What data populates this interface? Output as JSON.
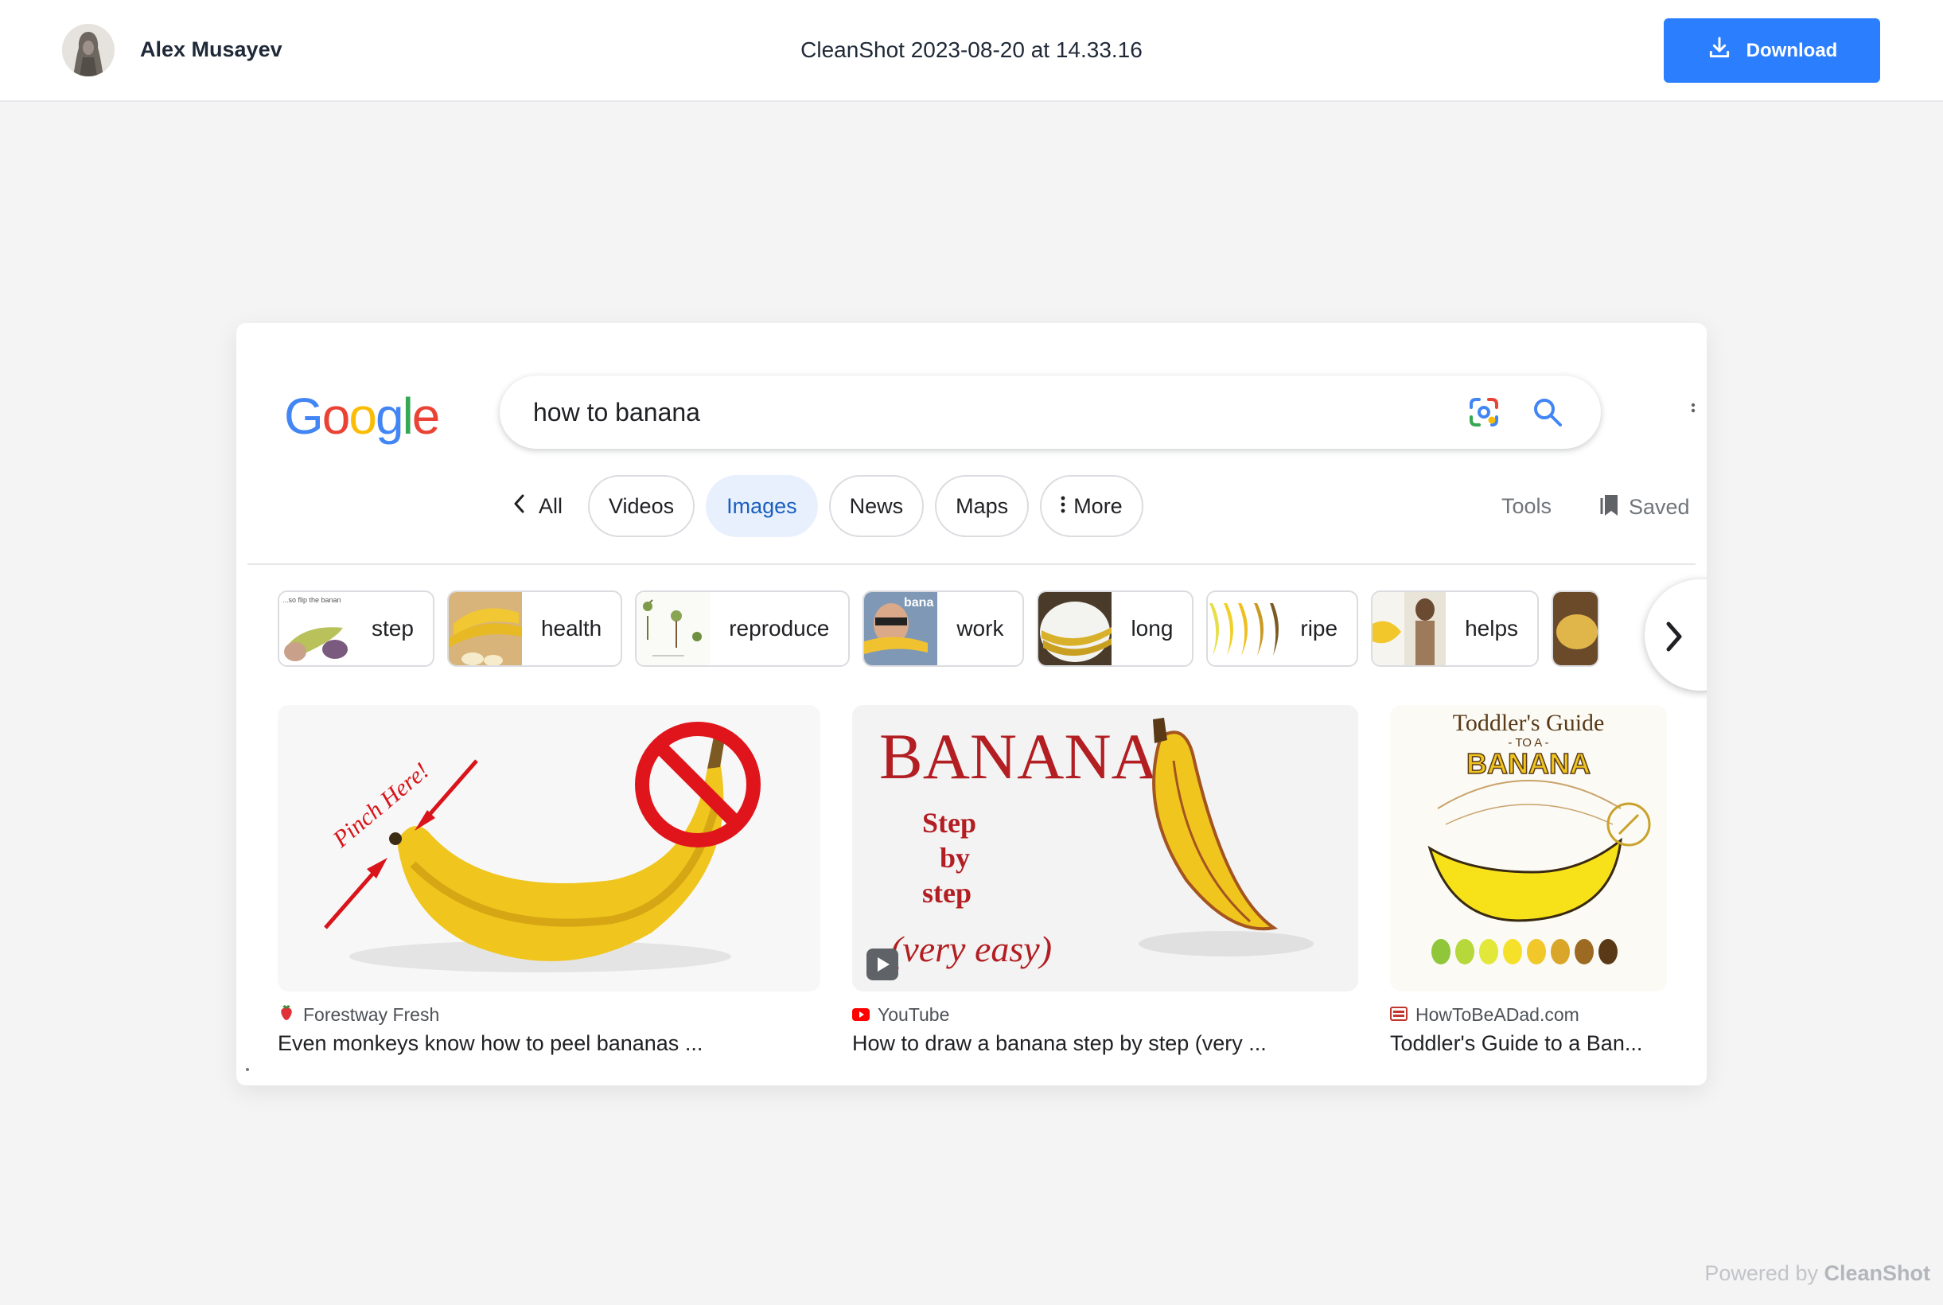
{
  "topbar": {
    "user_name": "Alex Musayev",
    "file_title": "CleanShot 2023-08-20 at 14.33.16",
    "download_label": "Download"
  },
  "footer": {
    "powered_prefix": "Powered by",
    "powered_brand": "CleanShot"
  },
  "screenshot": {
    "logo": [
      "G",
      "o",
      "o",
      "g",
      "l",
      "e"
    ],
    "logo_colors": [
      "#4285F4",
      "#EA4335",
      "#FBBC05",
      "#4285F4",
      "#34A853",
      "#EA4335"
    ],
    "search_query": "how to banana",
    "tabs": {
      "all": "All",
      "videos": "Videos",
      "images": "Images",
      "news": "News",
      "maps": "Maps",
      "more": "More"
    },
    "tools": "Tools",
    "saved": "Saved",
    "chips": [
      "step",
      "health",
      "reproduce",
      "work",
      "long",
      "ripe",
      "helps"
    ],
    "chip_thumb_caption": "...so flip the banan",
    "chip_work_thumb_text": "bana",
    "results": [
      {
        "source": "Forestway Fresh",
        "title": "Even monkeys know how to peel bananas ...",
        "image_text": "Pinch Here!"
      },
      {
        "source": "YouTube",
        "title": "How to draw a banana step by step (very ...",
        "image_text": {
          "heading": "BANANA",
          "line1": "Step",
          "line2": "by",
          "line3": "step",
          "line4": "(very easy)"
        }
      },
      {
        "source": "HowToBeADad.com",
        "title": "Toddler's Guide to a Ban...",
        "image_text": {
          "heading": "Toddler's Guide",
          "sub": "- TO A -",
          "banner": "BANANA"
        }
      }
    ],
    "colors": {
      "accent_blue": "#1a73e8",
      "active_tab_bg": "#e8f0fe",
      "banana_yellow": "#f2c417"
    }
  }
}
